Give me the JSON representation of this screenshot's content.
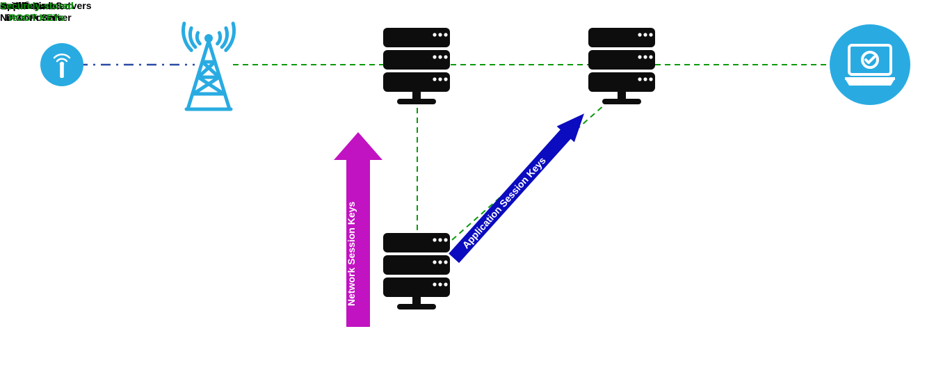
{
  "diagram": {
    "nodes": {
      "end_device": {
        "label": "End Device",
        "root_keys_note": "Securely-stored\nROOT KEYs"
      },
      "gateway": {
        "label": "Gateway"
      },
      "network_server": {
        "label_prefix": "LoRa",
        "label_reg": "®",
        "label_suffix": "-Enabled\nNetwork Server"
      },
      "application_servers": {
        "label": "Application Servers"
      },
      "dashboards": {
        "label": "Dashboards or\nData Portals"
      },
      "join_server": {
        "label": "Join Server",
        "root_keys_note": "Securely-stored\nROOT KEYs"
      }
    },
    "arrows": {
      "network_session_keys": {
        "label": "Network Session Keys",
        "color": "#c113c1"
      },
      "application_session_keys": {
        "label": "Application Session Keys",
        "color": "#0b0bbf"
      }
    },
    "colors": {
      "brand_blue": "#29abe2",
      "server_black": "#0d0d0d",
      "dash_green": "#0b9a0b",
      "dash_blue": "#2a4ba5"
    },
    "links": [
      {
        "from": "end_device",
        "to": "gateway",
        "style": "dash-dot-blue"
      },
      {
        "from": "gateway",
        "to": "network_server",
        "style": "dash-green"
      },
      {
        "from": "network_server",
        "to": "application_servers",
        "style": "dash-green"
      },
      {
        "from": "application_servers",
        "to": "dashboards",
        "style": "dash-green"
      },
      {
        "from": "network_server",
        "to": "join_server",
        "style": "dash-green-vertical"
      },
      {
        "from": "join_server",
        "to": "application_servers",
        "style": "dash-green-diagonal"
      }
    ]
  }
}
